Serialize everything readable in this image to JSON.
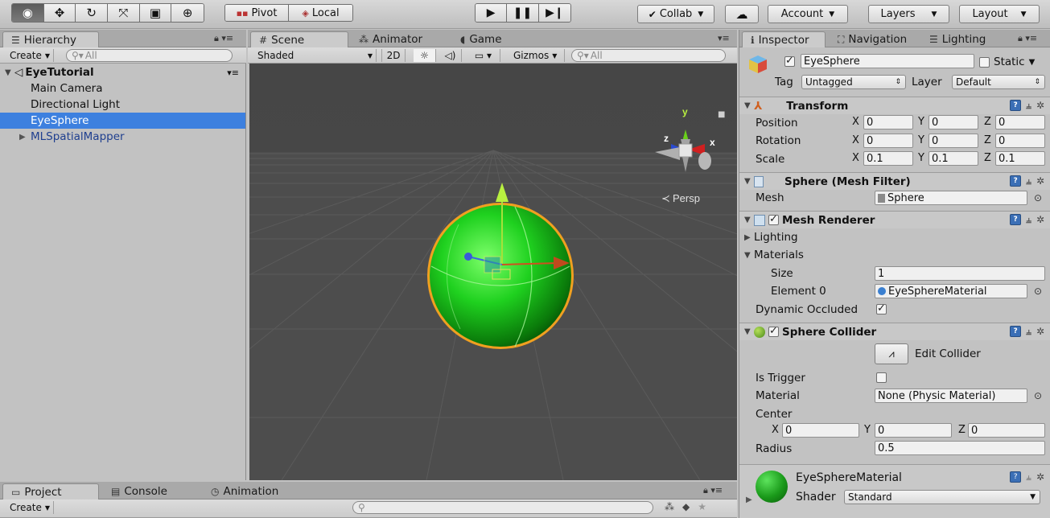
{
  "toolbar": {
    "pivot": "Pivot",
    "local": "Local",
    "collab": "Collab",
    "account": "Account",
    "layers": "Layers",
    "layout": "Layout"
  },
  "hierarchy": {
    "tab": "Hierarchy",
    "create": "Create",
    "search_placeholder": "All",
    "scene_name": "EyeTutorial",
    "items": [
      "Main Camera",
      "Directional Light",
      "EyeSphere",
      "MLSpatialMapper"
    ]
  },
  "scene": {
    "tabs": [
      "Scene",
      "Animator",
      "Game"
    ],
    "shading": "Shaded",
    "mode_2d": "2D",
    "gizmos": "Gizmos",
    "search_placeholder": "All",
    "persp_label": "Persp",
    "axis_y": "y",
    "axis_x": "x",
    "axis_z": "z"
  },
  "inspector": {
    "tabs": [
      "Inspector",
      "Navigation",
      "Lighting"
    ],
    "object_name": "EyeSphere",
    "static_label": "Static",
    "tag_label": "Tag",
    "tag_value": "Untagged",
    "layer_label": "Layer",
    "layer_value": "Default",
    "transform": {
      "title": "Transform",
      "position_label": "Position",
      "rotation_label": "Rotation",
      "scale_label": "Scale",
      "axis_labels": [
        "X",
        "Y",
        "Z"
      ],
      "position": [
        "0",
        "0",
        "0"
      ],
      "rotation": [
        "0",
        "0",
        "0"
      ],
      "scale": [
        "0.1",
        "0.1",
        "0.1"
      ]
    },
    "mesh_filter": {
      "title": "Sphere (Mesh Filter)",
      "mesh_label": "Mesh",
      "mesh_value": "Sphere"
    },
    "mesh_renderer": {
      "title": "Mesh Renderer",
      "lighting_label": "Lighting",
      "materials_label": "Materials",
      "size_label": "Size",
      "size_value": "1",
      "element0_label": "Element 0",
      "element0_value": "EyeSphereMaterial",
      "dynamic_occluded_label": "Dynamic Occluded"
    },
    "sphere_collider": {
      "title": "Sphere Collider",
      "edit_collider": "Edit Collider",
      "is_trigger_label": "Is Trigger",
      "material_label": "Material",
      "material_value": "None (Physic Material)",
      "center_label": "Center",
      "center": [
        "0",
        "0",
        "0"
      ],
      "radius_label": "Radius",
      "radius_value": "0.5"
    },
    "material": {
      "name": "EyeSphereMaterial",
      "shader_label": "Shader",
      "shader_value": "Standard"
    }
  },
  "project": {
    "tabs": [
      "Project",
      "Console",
      "Animation"
    ],
    "create": "Create"
  }
}
